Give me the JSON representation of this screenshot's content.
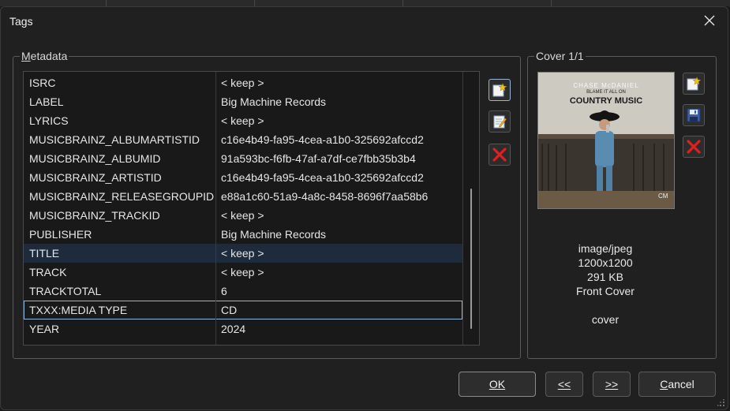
{
  "window": {
    "title": "Tags"
  },
  "metadata": {
    "group_label": "Metadata",
    "rows": [
      {
        "key": "ISRC",
        "value": "< keep >"
      },
      {
        "key": "LABEL",
        "value": "Big Machine Records"
      },
      {
        "key": "LYRICS",
        "value": "< keep >"
      },
      {
        "key": "MUSICBRAINZ_ALBUMARTISTID",
        "value": "c16e4b49-fa95-4cea-a1b0-325692afccd2"
      },
      {
        "key": "MUSICBRAINZ_ALBUMID",
        "value": "91a593bc-f6fb-47af-a7df-ce7fbb35b3b4"
      },
      {
        "key": "MUSICBRAINZ_ARTISTID",
        "value": "c16e4b49-fa95-4cea-a1b0-325692afccd2"
      },
      {
        "key": "MUSICBRAINZ_RELEASEGROUPID",
        "value": "e88a1c60-51a9-4a8c-8458-8696f7aa58b6"
      },
      {
        "key": "MUSICBRAINZ_TRACKID",
        "value": "< keep >"
      },
      {
        "key": "PUBLISHER",
        "value": "Big Machine Records"
      },
      {
        "key": "TITLE",
        "value": "< keep >"
      },
      {
        "key": "TRACK",
        "value": "< keep >"
      },
      {
        "key": "TRACKTOTAL",
        "value": "6"
      },
      {
        "key": "TXXX:MEDIA TYPE",
        "value": "CD"
      },
      {
        "key": "YEAR",
        "value": "2024"
      }
    ],
    "highlighted_row": "TITLE",
    "selected_row": "TXXX:MEDIA TYPE"
  },
  "cover": {
    "group_label": "Cover 1/1",
    "art_text": {
      "artist": "CHASE McDANIEL",
      "subtitle": "BLAME IT ALL ON",
      "title": "COUNTRY MUSIC",
      "mark": "CM"
    },
    "mime": "image/jpeg",
    "dimensions": "1200x1200",
    "size": "291 KB",
    "type": "Front Cover",
    "description": "cover"
  },
  "icons": {
    "close": "close-icon",
    "add": "add-tag-icon",
    "edit": "edit-tag-icon",
    "delete": "delete-tag-icon",
    "save": "save-cover-icon"
  },
  "buttons": {
    "ok": "OK",
    "prev": "<<",
    "next": ">>",
    "cancel": "Cancel"
  }
}
